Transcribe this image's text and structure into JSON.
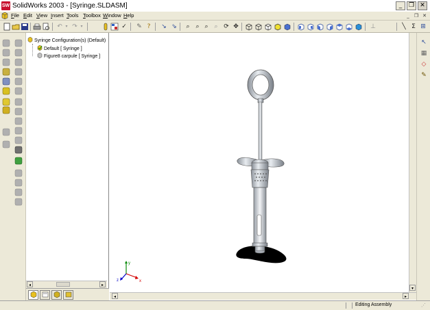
{
  "window": {
    "title": "SolidWorks 2003 - [Syringe.SLDASM]",
    "app_icon_text": "SW",
    "minimize": "_",
    "maximize": "❐",
    "close": "✕"
  },
  "menubar": {
    "items": [
      "File",
      "Edit",
      "View",
      "Insert",
      "Tools",
      "Toolbox",
      "Window",
      "Help"
    ],
    "doc_minimize": "_",
    "doc_restore": "❐",
    "doc_close": "✕"
  },
  "toolbar": {
    "icons": [
      "new-file-icon",
      "open-file-icon",
      "save-icon",
      "print-icon",
      "print-preview-icon",
      "undo-icon",
      "redo-icon",
      "info-icon",
      "rebuild-icon",
      "options-icon",
      "help-icon",
      "select-icon",
      "smart-select-icon",
      "zoom-to-fit-icon",
      "zoom-area-icon",
      "zoom-in-out-icon",
      "zoom-selection-icon",
      "rotate-icon",
      "pan-icon",
      "wireframe-icon",
      "hidden-lines-icon",
      "hidden-removed-icon",
      "shaded-edges-icon",
      "shaded-icon",
      "front-view-icon",
      "back-view-icon",
      "left-view-icon",
      "right-view-icon",
      "top-view-icon",
      "isometric-view-icon",
      "normal-to-icon",
      "line-icon",
      "sum-icon",
      "table-icon"
    ]
  },
  "feature_manager": {
    "root": "Syringe Configuration(s)  (Default)",
    "children": [
      "Default [ Syringe ]",
      "Figure8 carpule [ Syringe ]"
    ],
    "tabs": [
      "feature-tree-tab",
      "property-tab",
      "configuration-tab",
      "toolbox-tab"
    ]
  },
  "status": {
    "text": "Editing Assembly"
  },
  "colors": {
    "chrome": "#ece9d8",
    "titlebar": "#ffffff",
    "accent_red": "#c8102e",
    "model_metal": "#c8ccd0",
    "axis_x": "#d40000",
    "axis_y": "#0a8a0a",
    "axis_z": "#0000c8"
  },
  "axes": {
    "x": "x",
    "y": "y",
    "z": "z"
  }
}
